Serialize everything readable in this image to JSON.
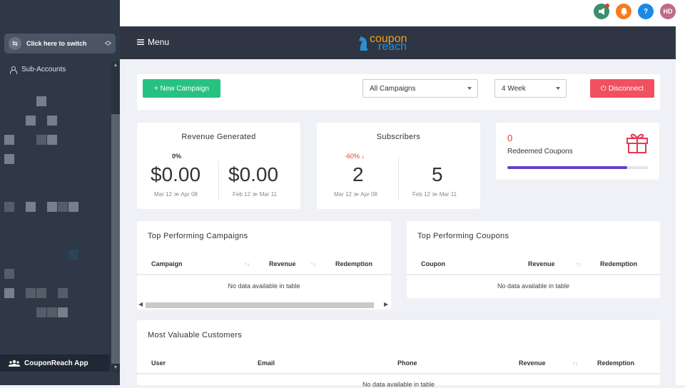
{
  "sidebar": {
    "switch_label": "Click here to switch",
    "sub_accounts_label": "Sub-Accounts",
    "app_label": "CouponReach App"
  },
  "topbar": {
    "user_initials": "HD",
    "help_label": "?"
  },
  "header": {
    "menu_label": "Menu",
    "logo_top": "coupon",
    "logo_bottom": "reach"
  },
  "toolbar": {
    "new_campaign_label": "+ New Campaign",
    "campaign_select_value": "All Campaigns",
    "period_select_value": "4 Week",
    "disconnect_label": "Disconnect"
  },
  "revenue": {
    "title": "Revenue Generated",
    "change": "0%",
    "current_value": "$0.00",
    "current_range": "Mar 12 ≫ Apr 08",
    "previous_value": "$0.00",
    "previous_range": "Feb 12 ≫ Mar 11"
  },
  "subscribers": {
    "title": "Subscribers",
    "change": "-60% ↓",
    "current_value": "2",
    "current_range": "Mar 12 ≫ Apr 08",
    "previous_value": "5",
    "previous_range": "Feb 12 ≫ Mar 11"
  },
  "redeemed": {
    "count": "0",
    "label": "Redeemed Coupons",
    "progress": 0.85
  },
  "top_campaigns": {
    "title": "Top Performing Campaigns",
    "columns": [
      "Campaign",
      "Revenue",
      "Redemption"
    ],
    "empty_text": "No data available in table"
  },
  "top_coupons": {
    "title": "Top Performing Coupons",
    "columns": [
      "Coupon",
      "Revenue",
      "Redemption"
    ],
    "empty_text": "No data available in table"
  },
  "customers": {
    "title": "Most Valuable Customers",
    "columns": [
      "User",
      "Email",
      "Phone",
      "Revenue",
      "Redemption"
    ],
    "empty_text": "No data available in table"
  },
  "colors": {
    "sidebar": "#2f3847",
    "header": "#2f3542",
    "green": "#26c281",
    "red": "#f0505f",
    "progress": "#6a3fc8"
  }
}
